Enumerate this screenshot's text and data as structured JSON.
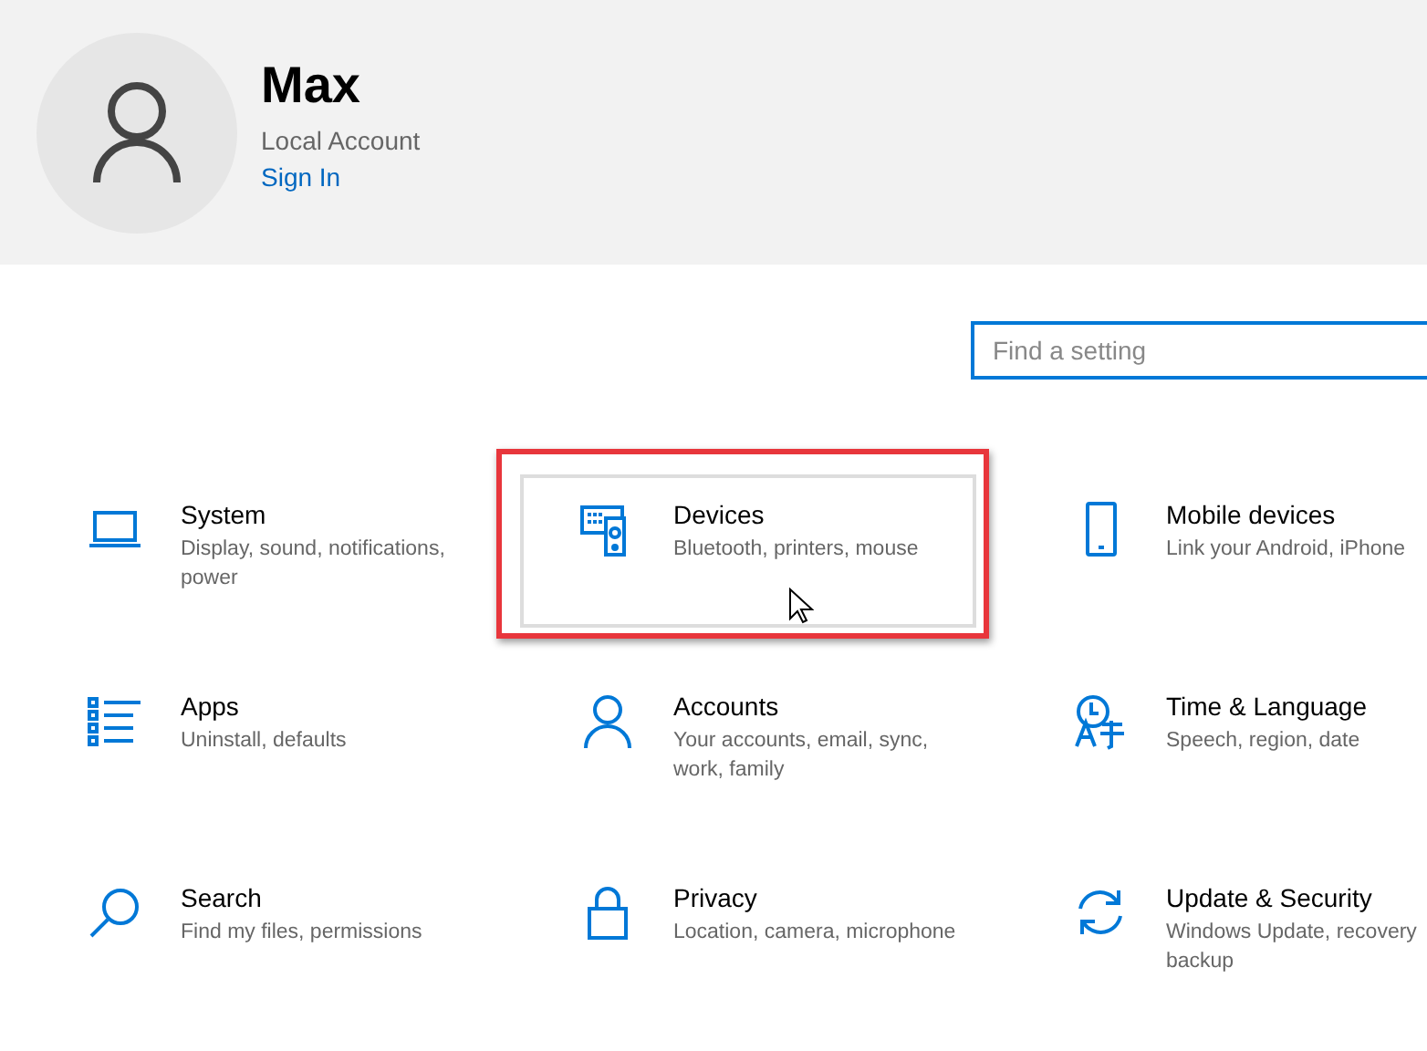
{
  "account": {
    "name": "Max",
    "type": "Local Account",
    "link": "Sign In"
  },
  "search": {
    "placeholder": "Find a setting"
  },
  "categories": [
    {
      "kind": "system",
      "title": "System",
      "description": "Display, sound, notifications, power",
      "highlighted": false
    },
    {
      "kind": "devices",
      "title": "Devices",
      "description": "Bluetooth, printers, mouse",
      "highlighted": true
    },
    {
      "kind": "phone",
      "title": "Mobile devices",
      "description": "Link your Android, iPhone",
      "highlighted": false
    },
    {
      "kind": "apps",
      "title": "Apps",
      "description": "Uninstall, defaults",
      "highlighted": false
    },
    {
      "kind": "accounts",
      "title": "Accounts",
      "description": "Your accounts, email, sync, work, family",
      "highlighted": false
    },
    {
      "kind": "time",
      "title": "Time & Language",
      "description": "Speech, region, date",
      "highlighted": false
    },
    {
      "kind": "search",
      "title": "Search",
      "description": "Find my files, permissions",
      "highlighted": false
    },
    {
      "kind": "privacy",
      "title": "Privacy",
      "description": "Location, camera, microphone",
      "highlighted": false
    },
    {
      "kind": "update",
      "title": "Update & Security",
      "description": "Windows Update, recovery backup",
      "highlighted": false
    }
  ]
}
